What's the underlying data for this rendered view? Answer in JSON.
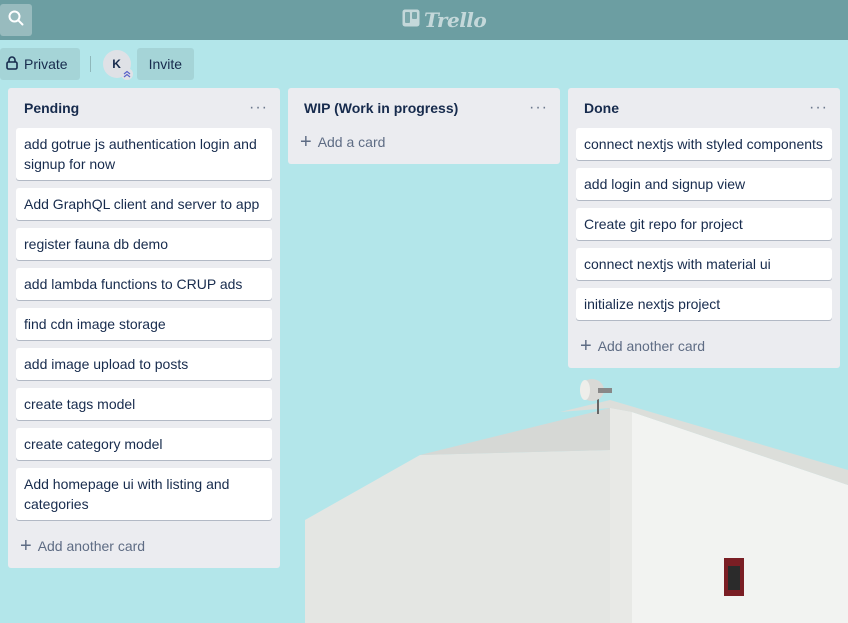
{
  "app": {
    "logo_text": "Trello"
  },
  "icons": {
    "search": "search-icon",
    "logo": "trello-board-icon",
    "lock": "lock-icon",
    "plus": "plus-icon",
    "more": "more-icon"
  },
  "colors": {
    "topbar": "#54868a",
    "background": "#b3e6ea",
    "list_bg": "#ebecf0",
    "card_bg": "#ffffff"
  },
  "board_header": {
    "visibility_label": "Private",
    "avatar_initial": "K",
    "invite_label": "Invite"
  },
  "lists": [
    {
      "title": "Pending",
      "menu": "···",
      "cards": [
        "add gotrue js authentication login and signup for now",
        "Add GraphQL client and server to app",
        "register fauna db demo",
        "add lambda functions to CRUP ads",
        "find cdn image storage",
        "add image upload to posts",
        "create tags model",
        "create category model",
        "Add homepage ui with listing and categories"
      ],
      "add_label": "Add another card"
    },
    {
      "title": "WIP (Work in progress)",
      "menu": "···",
      "cards": [],
      "add_label": "Add a card"
    },
    {
      "title": "Done",
      "menu": "···",
      "cards": [
        "connect nextjs with styled components",
        "add login and signup view",
        "Create git repo for project",
        "connect nextjs with material ui",
        "initialize nextjs project"
      ],
      "add_label": "Add another card"
    }
  ]
}
